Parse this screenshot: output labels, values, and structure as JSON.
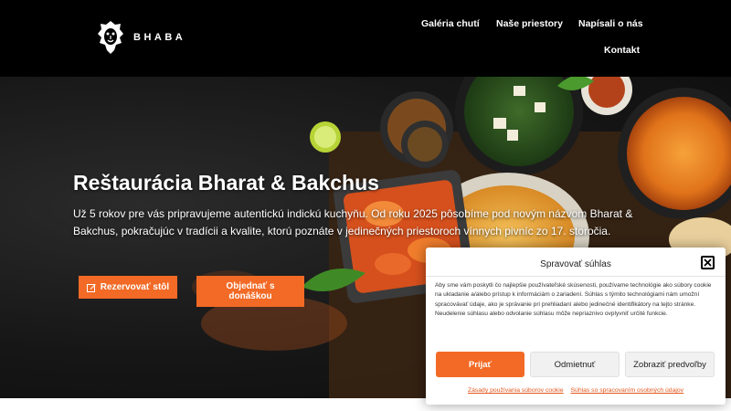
{
  "brand": {
    "name": "BHABA",
    "logo_icon": "lion-face-icon"
  },
  "nav": {
    "items": [
      {
        "label": "Galéria chutí"
      },
      {
        "label": "Naše priestory"
      },
      {
        "label": "Napísali o nás"
      },
      {
        "label": "Kontakt"
      }
    ]
  },
  "hero": {
    "title": "Reštaurácia Bharat & Bakchus",
    "text": "Už 5 rokov pre vás pripravujeme autentickú indickú kuchyňu. Od roku 2025 pôsobíme pod novým názvom Bharat & Bakchus, pokračujúc v tradícii a kvalite, ktorú poznáte v jedinečných priestoroch vínnych pivníc zo 17. storočia.",
    "reserve_label": "Rezervovať stôl",
    "reserve_icon": "edit-icon",
    "order_label": "Objednať s donáškou"
  },
  "cookie": {
    "title": "Spravovať súhlas",
    "close_icon": "close-icon",
    "body": "Aby sme vám poskytli čo najlepšie používateľské skúsenosti, používame technológie ako súbory cookie na ukladanie a/alebo prístup k informáciám o zariadení. Súhlas s týmito technológiami nám umožní spracovávať údaje, ako je správanie pri prehliadaní alebo jedinečné identifikátory na tejto stránke. Neudelenie súhlasu alebo odvolanie súhlasu môže nepriaznivo ovplyvniť určité funkcie.",
    "accept_label": "Prijať",
    "deny_label": "Odmietnuť",
    "prefs_label": "Zobraziť predvoľby",
    "link_cookies": "Zásady používania súborov cookie",
    "link_privacy": "Súhlas so spracovaním osobných údajov"
  },
  "colors": {
    "accent": "#f26a25",
    "header_bg": "#000000",
    "text_light": "#ffffff"
  }
}
